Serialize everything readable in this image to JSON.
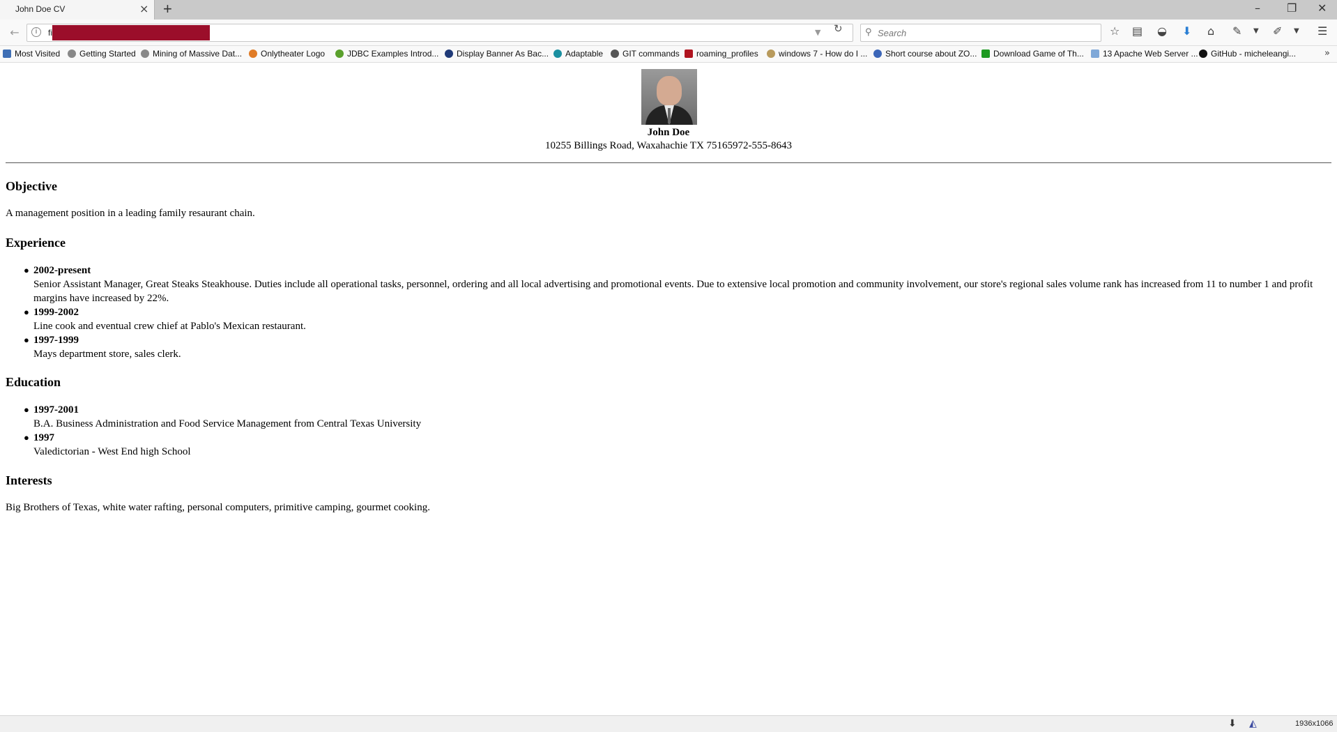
{
  "browser": {
    "tab_title": "John Doe CV",
    "url_prefix": "fi",
    "search_placeholder": "Search"
  },
  "bookmarks": [
    "Most Visited",
    "Getting Started",
    "Mining of Massive Dat...",
    "Onlytheater Logo",
    "JDBC Examples Introd...",
    "Display Banner As Bac...",
    "Adaptable",
    "GIT commands",
    "roaming_profiles",
    "windows 7 - How do I ...",
    "Short course about ZO...",
    "Download Game of Th...",
    "13 Apache Web Server ...",
    "GitHub - micheleangi..."
  ],
  "cv": {
    "name": "John Doe",
    "address": "10255 Billings Road, Waxahachie TX 75165972-555-8643",
    "objective_heading": "Objective",
    "objective_text": "A management position in a leading family resaurant chain.",
    "experience_heading": "Experience",
    "experience": [
      {
        "period": "2002-present",
        "text": "Senior Assistant Manager, Great Steaks Steakhouse. Duties include all operational tasks, personnel, ordering and all local advertising and promotional events. Due to extensive local promotion and community involvement, our store's regional sales volume rank has increased from 11 to number 1 and profit margins have increased by 22%."
      },
      {
        "period": "1999-2002",
        "text": "Line cook and eventual crew chief at Pablo's Mexican restaurant."
      },
      {
        "period": "1997-1999",
        "text": "Mays department store, sales clerk."
      }
    ],
    "education_heading": "Education",
    "education": [
      {
        "period": "1997-2001",
        "text": "B.A. Business Administration and Food Service Management from Central Texas University"
      },
      {
        "period": "1997",
        "text": "Valedictorian - West End high School"
      }
    ],
    "interests_heading": "Interests",
    "interests_text": "Big Brothers of Texas, white water rafting, personal computers, primitive camping, gourmet cooking."
  },
  "statusbar": {
    "dimensions": "1936x1066"
  }
}
